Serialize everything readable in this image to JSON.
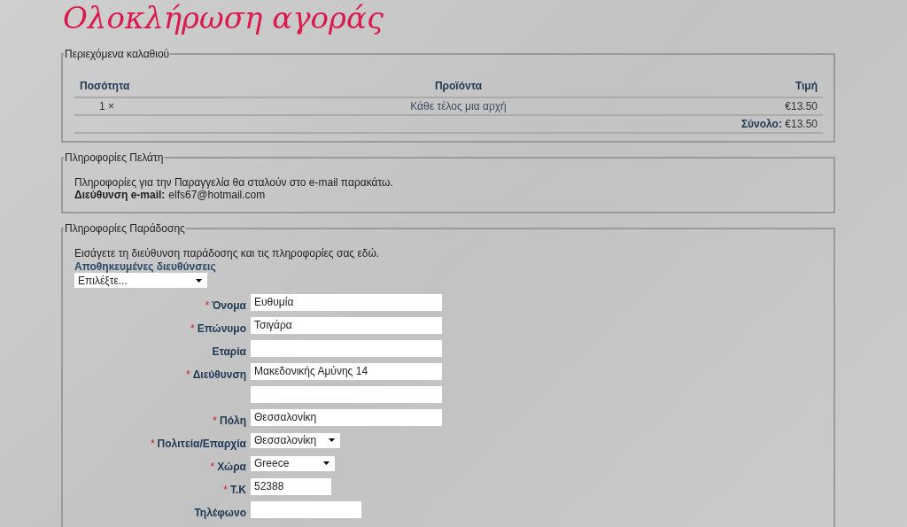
{
  "page_title": "Ολοκλήρωση αγοράς",
  "cart": {
    "legend": "Περιεχόμενα καλαθιού",
    "columns": [
      "Ποσότητα",
      "Προϊόντα",
      "Τιμή"
    ],
    "rows": [
      {
        "quantity": "1 ×",
        "product": "Κάθε τέλος μια αρχή",
        "price": "€13.50"
      }
    ],
    "total_label": "Σύνολο:",
    "total": "€13.50"
  },
  "customer": {
    "legend": "Πληροφορίες Πελάτη",
    "note": "Πληροφορίες για την Παραγγελία θα σταλούν στο e-mail παρακάτω.",
    "email_label": "Διεύθυνση e-mail:",
    "email": "elfs67@hotmail.com"
  },
  "delivery": {
    "legend": "Πληροφορίες Παράδοσης",
    "intro": "Εισάγετε τη διεύθυνση παράδοσης και τις πληροφορίες σας εδώ.",
    "saved_label": "Αποθηκευμένες διευθύνσεις",
    "saved_select": "Επιλέξτε...",
    "fields": [
      {
        "kind": "text",
        "mark": "*",
        "label": "Όνομα",
        "value": "Ευθυμία"
      },
      {
        "kind": "text",
        "mark": "*",
        "label": "Επώνυμο",
        "value": "Τσιγάρα"
      },
      {
        "kind": "text",
        "label": "Εταρία"
      },
      {
        "kind": "text",
        "mark": "*",
        "label": "Διεύθυνση",
        "value": "Μακεδονικής Αμύνης 14"
      },
      {
        "kind": "text"
      },
      {
        "kind": "text",
        "mark": "*",
        "label": "Πόλη",
        "value": "Θεσσαλονίκη"
      },
      {
        "kind": "select",
        "mark": "*",
        "label": "Πολιτεία/Επαρχία",
        "value": "Θεσσαλονίκη"
      },
      {
        "kind": "select",
        "mark": "*",
        "label": "Χώρα",
        "value": "Greece"
      },
      {
        "kind": "zip",
        "mark": "*",
        "label": "Τ.Κ",
        "value": "52388"
      },
      {
        "kind": "phone",
        "label": "Τηλέφωνο"
      }
    ]
  }
}
